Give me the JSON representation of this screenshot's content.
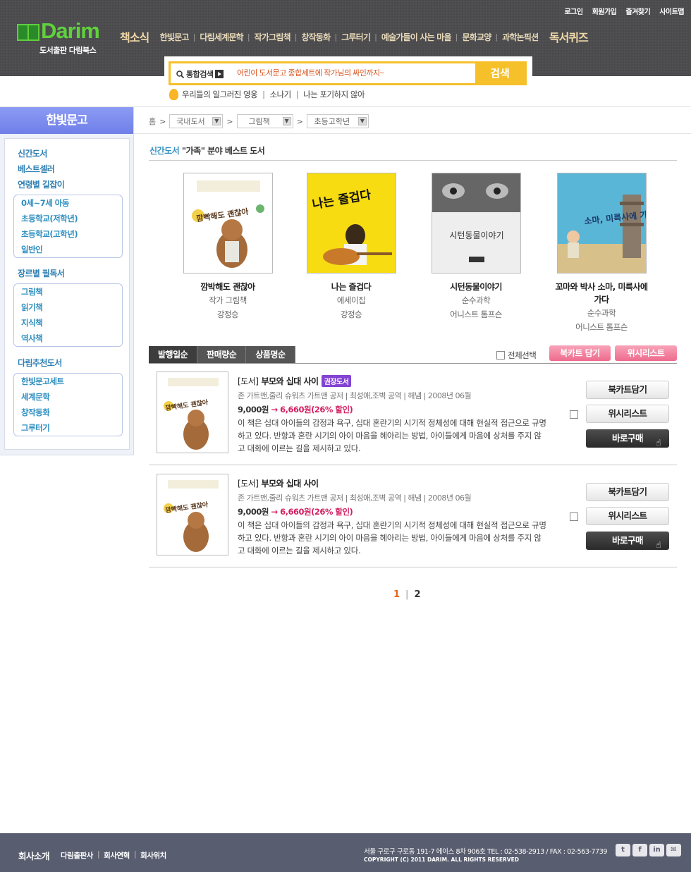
{
  "top_links": [
    "로그인",
    "회원가입",
    "즐겨찾기",
    "사이트맵"
  ],
  "logo": {
    "text": "Darim",
    "sub": "도서출판 다림북스"
  },
  "gnb": {
    "first": "책소식",
    "items": [
      "한빛문고",
      "다림세계문학",
      "작가그림책",
      "창작동화",
      "그루터기",
      "예술가들이 사는 마을",
      "문화교양",
      "과학논픽션"
    ],
    "last": "독서퀴즈"
  },
  "search": {
    "label": "통합검색",
    "value": "어린이 도서문고 종합세트에 작가님의 싸인까지~",
    "button": "검색"
  },
  "hotwords": [
    "우리들의 일그러진 영웅",
    "소나기",
    "나는 포기하지 않아"
  ],
  "sidebar": {
    "title": "한빛문고",
    "links_top": [
      "신간도서",
      "베스트셀러",
      "연령별 길잡이"
    ],
    "age": [
      "0세~7세 아동",
      "초등학교(저학년)",
      "초등학교(고학년)",
      "일반인"
    ],
    "genre_title": "장르별 필독서",
    "genre": [
      "그림책",
      "읽기책",
      "지식책",
      "역사책"
    ],
    "rec_title": "다림추천도서",
    "rec": [
      "한빛문고세트",
      "세계문학",
      "창작동화",
      "그루터기"
    ]
  },
  "breadcrumb": {
    "home": "홈",
    "sel1": "국내도서",
    "sel2": "그림책",
    "sel3": "초등고학년"
  },
  "section": {
    "prefix": "신간도서",
    "title": "\"가족\" 분야 베스트 도서"
  },
  "best": [
    {
      "title": "깜박해도 괜찮아",
      "cat": "작가 그림책",
      "author": "강정승",
      "cover": "깜빡해도 괜찮아"
    },
    {
      "title": "나는 즐겁다",
      "cat": "에세이집",
      "author": "강정승",
      "cover": "나는 즐겁다"
    },
    {
      "title": "시턴동물이야기",
      "cat": "순수과학",
      "author": "어니스트 톰프슨",
      "cover": "시턴동물이야기"
    },
    {
      "title": "꼬마와 박사 소마, 미륵사에 가다",
      "cat": "순수과학",
      "author": "어니스트 톰프슨",
      "cover": "소마, 미륵사에 가다"
    }
  ],
  "tabs": [
    "발행일순",
    "판매량순",
    "상품명순"
  ],
  "select_all": "전체선택",
  "btn_cart": "북카트 담기",
  "btn_wish": "위시리스트",
  "list": [
    {
      "type": "[도서]",
      "title": "부모와 십대 사이",
      "badge": "권장도서",
      "meta": "존 가트맨,줄리 슈워츠 가트맨 공저  |  최성애,조벽 공역  |  해냄  |  2008년 06월",
      "price": "9,000원",
      "arrow": "→",
      "sale": "6,660원(26% 할인)",
      "desc": "이 책은 십대 아이들의 감정과 욕구, 십대 혼란기의 시기적 정체성에 대해 현실적 접근으로 규명하고 있다. 반항과 혼란 시기의 아이 마음을 헤아리는 방법, 아이들에게 마음에 상처를 주지 않고 대화에 이르는 길을 제시하고 있다.",
      "cart": "북카트담기",
      "wish": "위시리스트",
      "buy": "바로구매"
    },
    {
      "type": "[도서]",
      "title": "부모와 십대 사이",
      "badge": "",
      "meta": "존 가트맨,줄리 슈워츠 가트맨 공저  |  최성애,조벽 공역  |  해냄  |  2008년 06월",
      "price": "9,000원",
      "arrow": "→",
      "sale": "6,660원(26% 할인)",
      "desc": "이 책은 십대 아이들의 감정과 욕구, 십대 혼란기의 시기적 정체성에 대해 현실적 접근으로 규명하고 있다. 반항과 혼란 시기의 아이 마음을 헤아리는 방법, 아이들에게 마음에 상처를 주지 않고 대화에 이르는 길을 제시하고 있다.",
      "cart": "북카트담기",
      "wish": "위시리스트",
      "buy": "바로구매"
    }
  ],
  "pager": {
    "current": "1",
    "next": "2",
    "sep": "|"
  },
  "footer": {
    "title": "회사소개",
    "links": [
      "다림출판사",
      "회사연혁",
      "회사위치"
    ],
    "address": "서울 구로구 구로동 191-7 에이스 8차 906호  TEL : 02-538-2913 / FAX : 02-563-7739",
    "copyright": "COPYRIGHT (C) 2011 DARIM. ALL RIGHTS RESERVED",
    "sns": [
      "t",
      "f",
      "in",
      "✉"
    ]
  }
}
